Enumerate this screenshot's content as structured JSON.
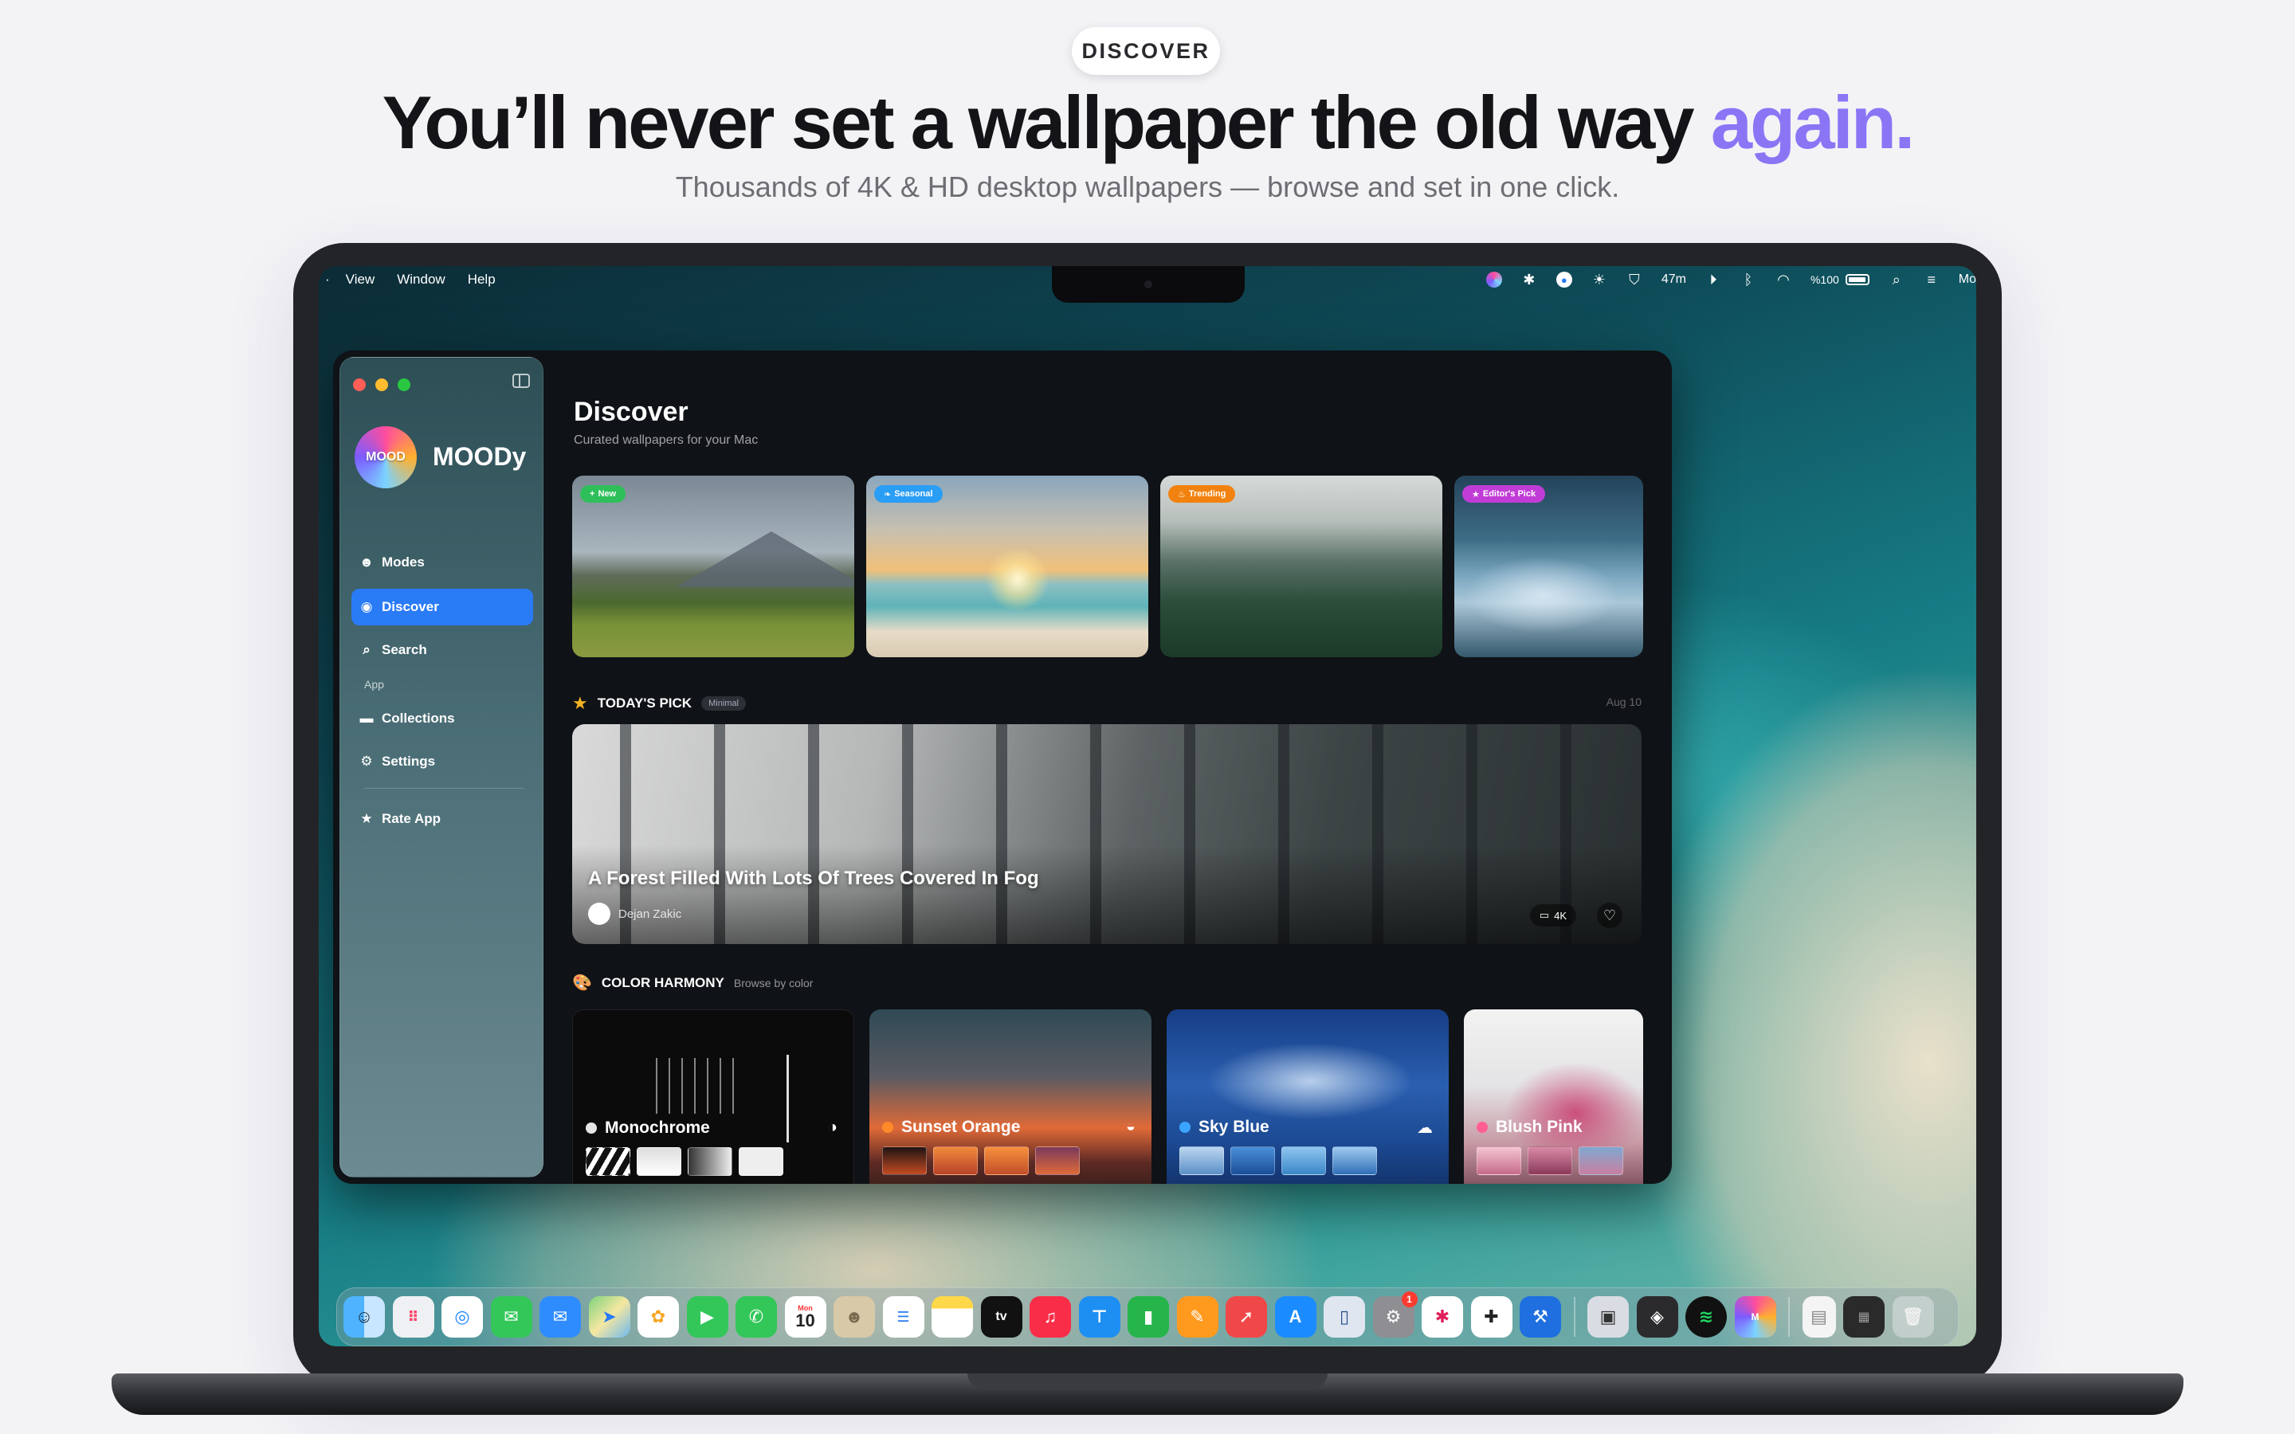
{
  "hero": {
    "eyebrow": "DISCOVER",
    "headline_main": "You’ll never set a wallpaper the old way ",
    "headline_accent": "again.",
    "subtitle": "Thousands of 4K & HD desktop wallpapers — browse and set in one click.",
    "accent_color": "#8b75f5"
  },
  "menubar": {
    "items": [
      "View",
      "Window",
      "Help"
    ],
    "status": {
      "timer": "47m",
      "battery": "%100",
      "cut_text": "Mo"
    }
  },
  "sidebar": {
    "brand": "MOODy",
    "logo_text": "MOOD",
    "items": [
      {
        "label": "Modes",
        "icon": "masks-icon"
      },
      {
        "label": "Discover",
        "icon": "compass-icon",
        "active": true
      },
      {
        "label": "Search",
        "icon": "search-icon"
      }
    ],
    "section_label": "App",
    "app_items": [
      {
        "label": "Collections",
        "icon": "folder-icon"
      },
      {
        "label": "Settings",
        "icon": "gear-icon"
      }
    ],
    "rate": "Rate App"
  },
  "main": {
    "title": "Discover",
    "subtitle": "Curated wallpapers for your Mac",
    "featured": [
      {
        "badge": "New",
        "badge_color": "#2fbf5a"
      },
      {
        "badge": "Seasonal",
        "badge_color": "#2a9df4"
      },
      {
        "badge": "Trending",
        "badge_color": "#f2820f"
      },
      {
        "badge": "Editor's Pick",
        "badge_color": "#c13cd6"
      }
    ],
    "todays_pick": {
      "label": "TODAY'S PICK",
      "tag": "Minimal",
      "date": "Aug 10",
      "title": "A Forest Filled With Lots Of Trees Covered In Fog",
      "author": "Dejan Zakic",
      "quality": "4K"
    },
    "color_harmony": {
      "label": "COLOR HARMONY",
      "hint": "Browse by color",
      "cards": [
        {
          "name": "Monochrome",
          "dot": "#e6e6e6"
        },
        {
          "name": "Sunset Orange",
          "dot": "#ff8a2a"
        },
        {
          "name": "Sky Blue",
          "dot": "#3aa5ff"
        },
        {
          "name": "Blush Pink",
          "dot": "#ff5f93"
        }
      ]
    }
  },
  "dock": {
    "calendar_day": "10",
    "calendar_month": "Mon",
    "badge_count": "1"
  }
}
